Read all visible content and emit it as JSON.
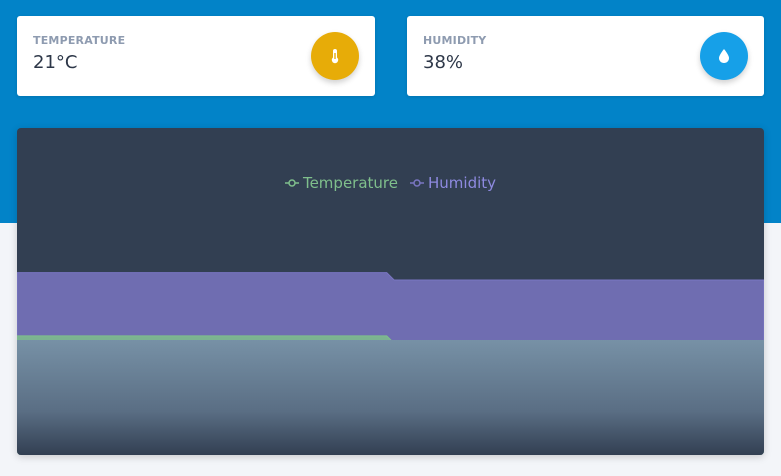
{
  "cards": [
    {
      "label": "TEMPERATURE",
      "value": "21°C",
      "icon": "thermometer-icon",
      "icon_color": "#e7ac08"
    },
    {
      "label": "HUMIDITY",
      "value": "38%",
      "icon": "water-drop-icon",
      "icon_color": "#16a0e8"
    }
  ],
  "colors": {
    "header_band": "#0283c8",
    "chart_background": "#323f52",
    "temperature": "#7fbf8c",
    "humidity": "#7a76c2"
  },
  "chart_data": {
    "type": "area",
    "legend": [
      "Temperature",
      "Humidity"
    ],
    "legend_position": "top-center",
    "grid": false,
    "series": [
      {
        "name": "Temperature",
        "values": [
          21,
          21,
          21,
          21,
          21,
          21,
          21,
          21,
          21,
          21,
          21,
          21,
          21,
          21,
          21,
          21,
          21,
          21,
          21,
          21,
          21,
          21,
          21,
          21,
          21,
          21,
          21,
          21,
          21,
          21,
          21,
          21,
          21,
          21,
          21,
          21,
          21,
          21,
          21,
          21,
          21,
          21,
          21,
          21,
          21,
          21,
          21,
          21,
          21,
          21,
          19,
          19,
          19,
          19,
          19,
          19,
          19,
          19,
          19,
          19,
          19,
          19,
          19,
          19,
          19,
          19,
          19,
          19,
          19,
          19,
          19,
          19,
          19,
          19,
          19,
          19,
          19,
          19,
          19,
          19,
          19,
          19,
          19,
          19,
          19,
          19,
          19,
          19,
          19,
          19,
          19,
          19,
          19,
          19,
          19,
          19,
          19,
          19,
          19,
          19
        ]
      },
      {
        "name": "Humidity",
        "values": [
          38,
          38,
          38,
          38,
          38,
          38,
          38,
          38,
          38,
          38,
          38,
          38,
          38,
          38,
          38,
          38,
          38,
          38,
          38,
          38,
          38,
          38,
          38,
          38,
          38,
          38,
          38,
          38,
          38,
          38,
          38,
          38,
          38,
          38,
          38,
          38,
          38,
          38,
          38,
          38,
          38,
          38,
          38,
          38,
          38,
          38,
          38,
          38,
          38,
          38,
          36,
          36,
          36,
          36,
          36,
          36,
          36,
          36,
          36,
          36,
          36,
          36,
          36,
          36,
          36,
          36,
          36,
          36,
          36,
          36,
          36,
          36,
          36,
          36,
          36,
          36,
          36,
          36,
          36,
          36,
          36,
          36,
          36,
          36,
          36,
          36,
          36,
          36,
          36,
          36,
          36,
          36,
          36,
          36,
          36,
          36,
          36,
          36,
          36,
          36
        ]
      }
    ]
  }
}
